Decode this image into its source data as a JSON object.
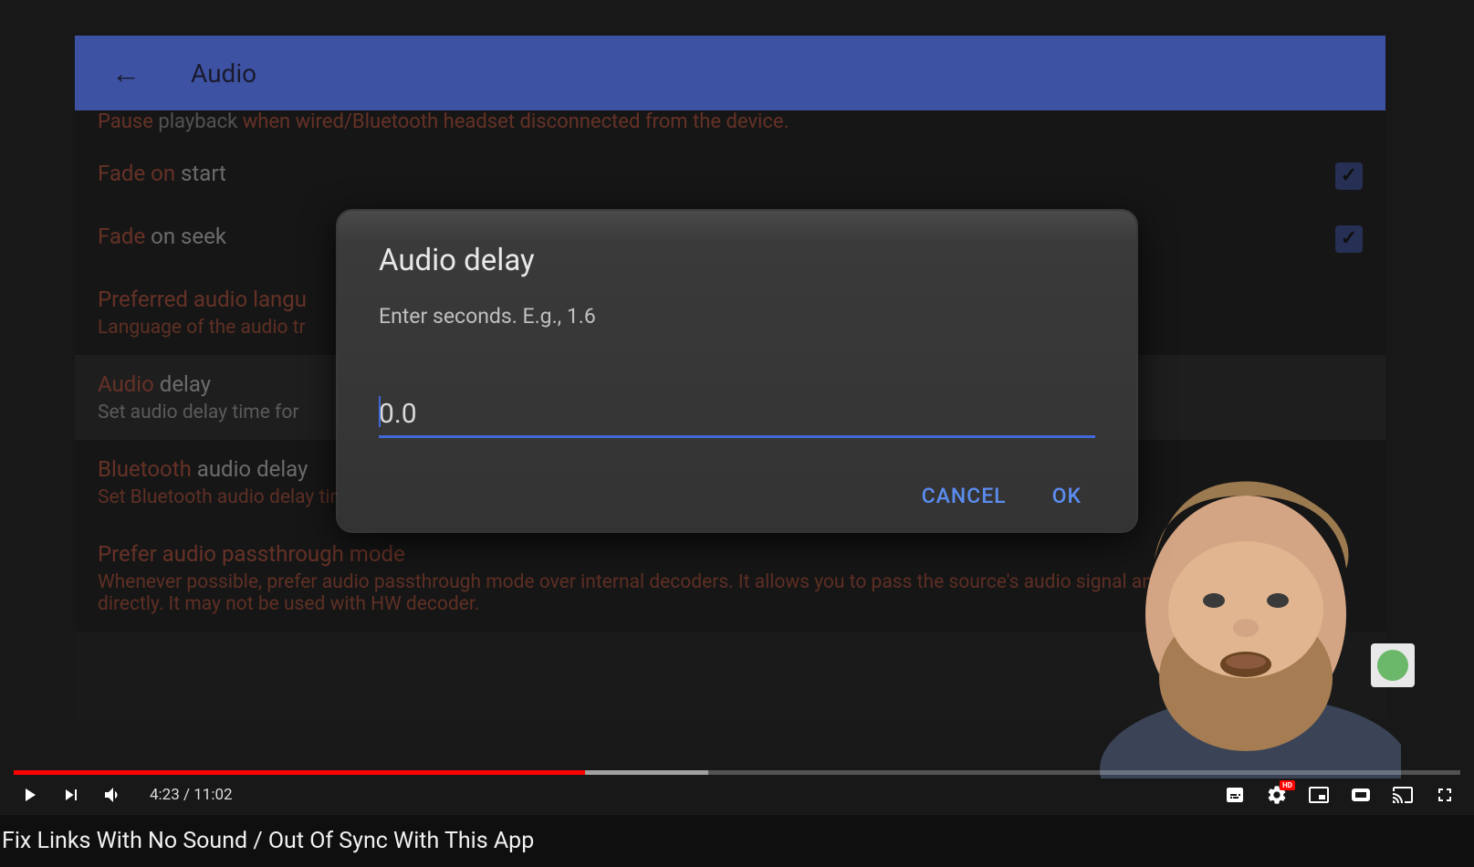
{
  "app": {
    "header_title": "Audio",
    "partial_top_text": "Pause playback when wired/Bluetooth headset disconnected from the device.",
    "settings": [
      {
        "title_hl": "Fade on",
        "title_plain": " start",
        "subtitle": "",
        "checked": true
      },
      {
        "title_hl": "Fade",
        "title_plain": " on seek",
        "subtitle": "",
        "checked": true
      },
      {
        "title_hl": "Preferred audio langu",
        "title_plain": "",
        "subtitle_hl": "Language of the audio tr",
        "subtitle_plain": ""
      },
      {
        "title_hl": "Audio",
        "title_plain": " delay",
        "subtitle_hl": "",
        "subtitle_plain": "Set audio delay time for ",
        "highlighted": true
      },
      {
        "title_hl": "Bluetooth",
        "title_plain": " audio delay",
        "subtitle_hl": "Set Bluetooth audio delay time for audio synchronization. It may not be used with HW decoder.",
        "subtitle_plain": ""
      },
      {
        "title_hl": "Prefer audio passthrough mode",
        "title_plain": "",
        "subtitle_hl": "Whenever possible, prefer audio passthrough mode over internal decoders. It allows you to pass the source's audio signal an external receiver directly. It may not be used with HW decoder.",
        "subtitle_plain": ""
      }
    ]
  },
  "dialog": {
    "title": "Audio delay",
    "subtitle": "Enter seconds. E.g., 1.6",
    "input_value": "0.0",
    "cancel": "CANCEL",
    "ok": "OK"
  },
  "player": {
    "current_time": "4:23",
    "duration": "11:02",
    "separator": " / "
  },
  "video_title": "Fix Links With No Sound / Out Of Sync With This App"
}
